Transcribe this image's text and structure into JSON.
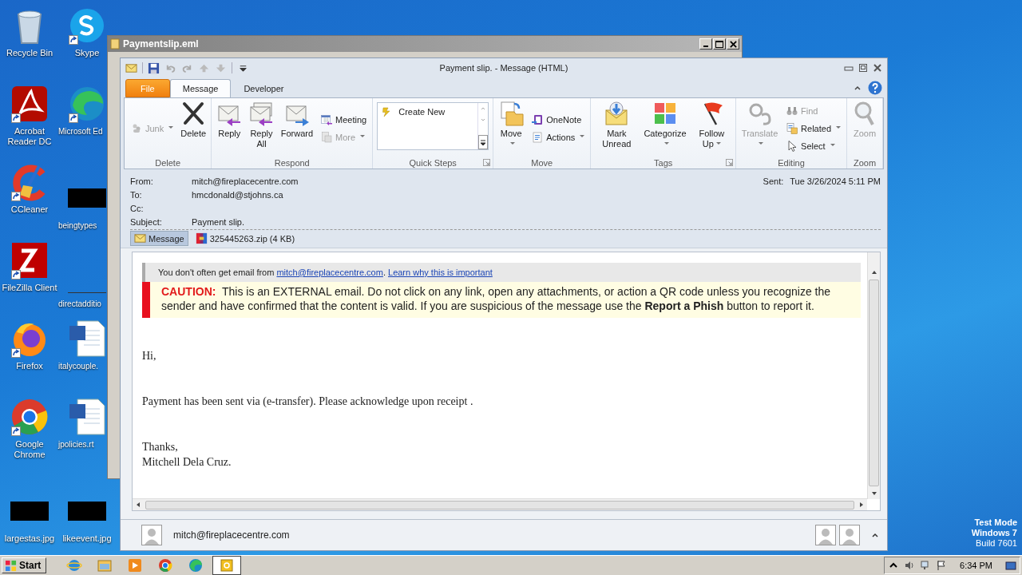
{
  "desktop": {
    "icons": [
      {
        "label": "Recycle Bin"
      },
      {
        "label": "Acrobat Reader DC"
      },
      {
        "label": "CCleaner"
      },
      {
        "label": "FileZilla Client"
      },
      {
        "label": "Firefox"
      },
      {
        "label": "Google Chrome"
      },
      {
        "label": "largestas.jpg"
      },
      {
        "label": "Skype"
      },
      {
        "label": "Microsoft Ed"
      },
      {
        "label": "beingtypes"
      },
      {
        "label": "directadditio"
      },
      {
        "label": "italycouple."
      },
      {
        "label": "jpolicies.rt"
      },
      {
        "label": "likeevent.jpg"
      }
    ]
  },
  "background_window": {
    "title": "Paymentslip.eml"
  },
  "window": {
    "title": "Payment slip. - Message (HTML)"
  },
  "tabs": [
    {
      "label": "File",
      "kind": "file",
      "selected": false
    },
    {
      "label": "Message",
      "kind": "tab",
      "selected": true
    },
    {
      "label": "Developer",
      "kind": "tab",
      "selected": false
    }
  ],
  "ribbon": {
    "groups": [
      {
        "label": "Delete",
        "launcher": false,
        "items": [
          {
            "kind": "small",
            "label": "Junk",
            "disabled": true,
            "dropdown": true
          },
          {
            "kind": "large",
            "label": "Delete",
            "disabled": false,
            "dropdown": false
          }
        ]
      },
      {
        "label": "Respond",
        "launcher": false,
        "items": [
          {
            "kind": "large",
            "label": "Reply",
            "disabled": false,
            "dropdown": false
          },
          {
            "kind": "large",
            "label": "Reply All",
            "disabled": false,
            "dropdown": false
          },
          {
            "kind": "large",
            "label": "Forward",
            "disabled": false,
            "dropdown": false
          },
          {
            "kind": "small",
            "label": "Meeting",
            "disabled": false,
            "dropdown": false
          },
          {
            "kind": "small",
            "label": "More",
            "disabled": true,
            "dropdown": true
          }
        ]
      },
      {
        "label": "Quick Steps",
        "launcher": true,
        "items": [
          {
            "kind": "gallery",
            "label": "Create New",
            "disabled": false,
            "dropdown": false
          }
        ]
      },
      {
        "label": "Move",
        "launcher": false,
        "items": [
          {
            "kind": "large",
            "label": "Move",
            "disabled": false,
            "dropdown": true
          },
          {
            "kind": "small",
            "label": "OneNote",
            "disabled": false,
            "dropdown": false
          },
          {
            "kind": "small",
            "label": "Actions",
            "disabled": false,
            "dropdown": true
          }
        ]
      },
      {
        "label": "Tags",
        "launcher": true,
        "items": [
          {
            "kind": "large",
            "label": "Mark Unread",
            "disabled": false,
            "dropdown": false
          },
          {
            "kind": "large",
            "label": "Categorize",
            "disabled": false,
            "dropdown": true
          },
          {
            "kind": "large",
            "label": "Follow Up",
            "disabled": false,
            "dropdown": true
          }
        ]
      },
      {
        "label": "Editing",
        "launcher": false,
        "items": [
          {
            "kind": "large",
            "label": "Translate",
            "disabled": true,
            "dropdown": true
          },
          {
            "kind": "small",
            "label": "Find",
            "disabled": true,
            "dropdown": false
          },
          {
            "kind": "small",
            "label": "Related",
            "disabled": false,
            "dropdown": true
          },
          {
            "kind": "small",
            "label": "Select",
            "disabled": false,
            "dropdown": true
          }
        ]
      },
      {
        "label": "Zoom",
        "launcher": false,
        "items": [
          {
            "kind": "large",
            "label": "Zoom",
            "disabled": true,
            "dropdown": false
          }
        ]
      }
    ]
  },
  "header": {
    "fields": [
      {
        "label": "From:",
        "value": "mitch@fireplacecentre.com"
      },
      {
        "label": "To:",
        "value": "hmcdonald@stjohns.ca"
      },
      {
        "label": "Cc:"
      },
      {
        "label": "Subject:",
        "value": "Payment slip."
      }
    ],
    "sent": {
      "label": "Sent:",
      "value": "Tue 3/26/2024 5:11 PM"
    },
    "attachments": [
      {
        "label": "Message",
        "kind": "message",
        "selected": true
      },
      {
        "label": "325445263.zip (4 KB)",
        "kind": "zip",
        "selected": false
      }
    ]
  },
  "message": {
    "notice": {
      "text": "You don't often get email from ",
      "sender_link": "mitch@fireplacecentre.com",
      "separator": ". ",
      "learn_link": "Learn why this is important"
    },
    "caution": {
      "label": "CAUTION:",
      "text": "This is an EXTERNAL email.  Do not click on any link, open any attachments, or action a QR code unless you recognize the sender and have confirmed that the content is valid.   If you are suspicious of the message use the **Report a Phish** button to report it."
    },
    "paragraphs": [
      [
        "Hi,"
      ],
      [
        "Payment has been sent via (e-transfer). Please acknowledge upon receipt ."
      ],
      [
        "Thanks,",
        "Mitchell Dela Cruz."
      ]
    ]
  },
  "people_pane": {
    "sender": "mitch@fireplacecentre.com"
  },
  "os_notice": [
    "Test Mode",
    "Windows 7",
    "Build 7601"
  ],
  "taskbar": {
    "start": "Start",
    "time": "6:34 PM"
  }
}
